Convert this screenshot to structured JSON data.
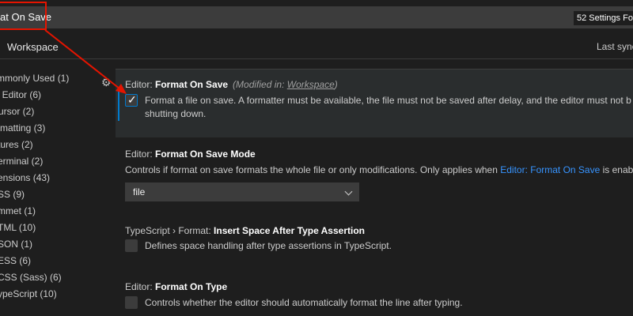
{
  "search": {
    "value": "at On Save",
    "count_badge": "52 Settings Fou"
  },
  "scope_tabs": {
    "workspace": "Workspace",
    "last_synced": "Last sync"
  },
  "toc": [
    {
      "label": "mmonly Used (1)"
    },
    {
      "label": "t Editor (6)"
    },
    {
      "label": "ursor (2)"
    },
    {
      "label": "rmatting (3)"
    },
    {
      "label": "tures (2)"
    },
    {
      "label": "erminal (2)"
    },
    {
      "label": "ensions (43)"
    },
    {
      "label": "SS (9)"
    },
    {
      "label": "mmet (1)"
    },
    {
      "label": "TML (10)"
    },
    {
      "label": "SON (1)"
    },
    {
      "label": "ESS (6)"
    },
    {
      "label": "CSS (Sass) (6)"
    },
    {
      "label": "ypeScript (10)"
    }
  ],
  "settings": [
    {
      "category": "Editor: ",
      "name": "Format On Save",
      "modified_prefix": "(Modified in: ",
      "modified_scope": "Workspace",
      "modified_suffix": ")",
      "desc_line1": "Format a file on save. A formatter must be available, the file must not be saved after delay, and the editor must not b",
      "desc_line2": "shutting down.",
      "checked": true
    },
    {
      "category": "Editor: ",
      "name": "Format On Save Mode",
      "desc_pre": "Controls if format on save formats the whole file or only modifications. Only applies when ",
      "desc_link": "Editor: Format On Save",
      "desc_post": " is enab",
      "select_value": "file"
    },
    {
      "category": "TypeScript › Format: ",
      "name": "Insert Space After Type Assertion",
      "desc": "Defines space handling after type assertions in TypeScript.",
      "checked": false
    },
    {
      "category": "Editor: ",
      "name": "Format On Type",
      "desc": "Controls whether the editor should automatically format the line after typing.",
      "checked": false
    }
  ],
  "colors": {
    "background": "#1e1e1e",
    "accent": "#007acc",
    "link": "#3794ff",
    "annotation": "#e51400"
  },
  "icons": {
    "gear": "gear-icon",
    "check": "check-icon",
    "chevron": "chevron-down-icon"
  }
}
